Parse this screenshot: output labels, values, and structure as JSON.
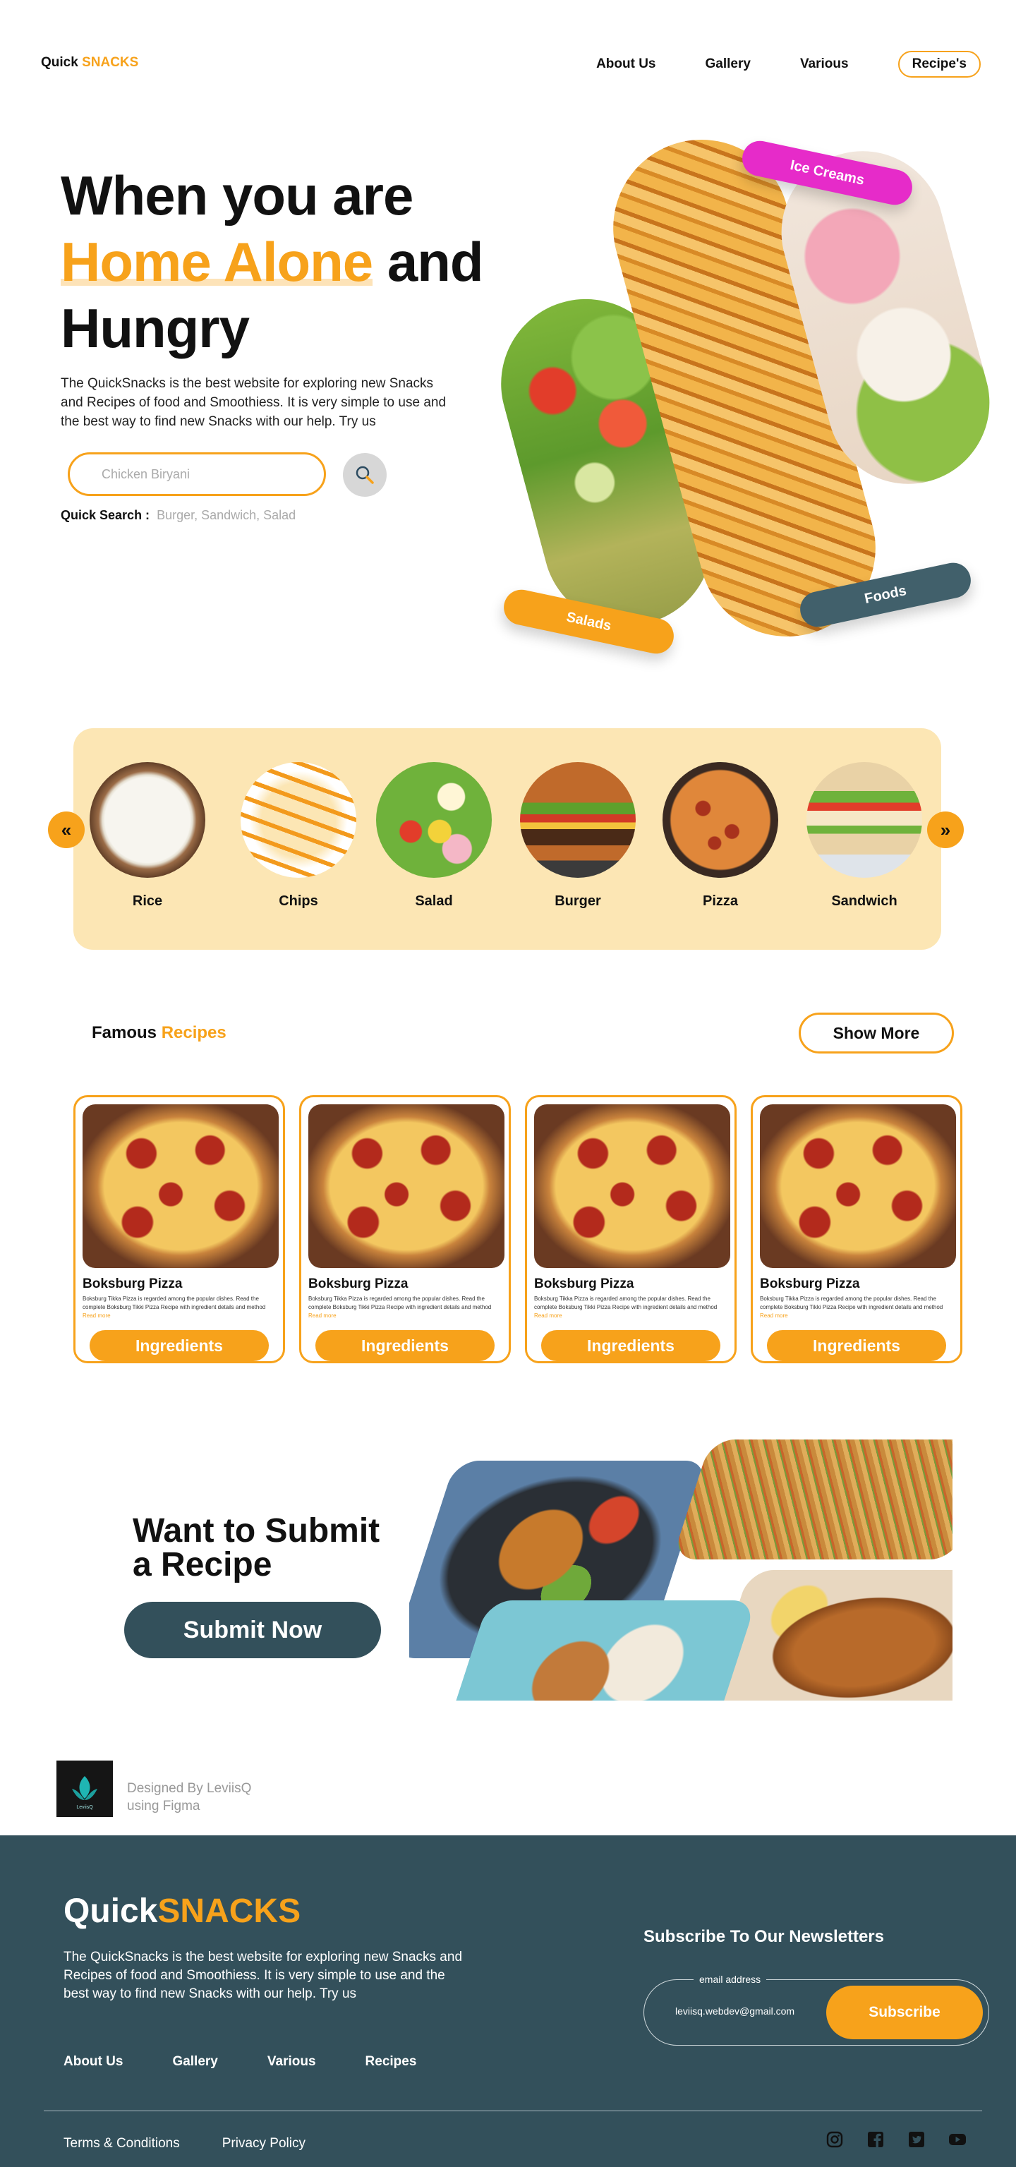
{
  "brand": {
    "quick": "Quick",
    "snacks": "SNACKS"
  },
  "nav": {
    "items": [
      {
        "label": "About Us"
      },
      {
        "label": "Gallery"
      },
      {
        "label": "Various"
      }
    ],
    "cta": "Recipe's"
  },
  "hero": {
    "line1": "When you are",
    "highlight": "Home Alone",
    "and": " and",
    "line3": "Hungry",
    "description": "The QuickSnacks is the best website for exploring new Snacks and Recipes of food and Smoothiess. It is very simple to use and the best way to find new Snacks with our help. Try us",
    "search_placeholder": "Chicken Biryani",
    "quick_search_label": "Quick Search :",
    "quick_search_tags": "Burger, Sandwich, Salad",
    "tags": {
      "ice_creams": "Ice Creams",
      "salads": "Salads",
      "foods": "Foods"
    },
    "colors": {
      "ice_tag": "#e62bc9",
      "salad_tag": "#f7a21b",
      "food_tag": "#41606b"
    }
  },
  "categories": {
    "prev_icon": "double-chevron-left-icon",
    "next_icon": "double-chevron-right-icon",
    "items": [
      {
        "label": "Rice"
      },
      {
        "label": "Chips"
      },
      {
        "label": "Salad"
      },
      {
        "label": "Burger"
      },
      {
        "label": "Pizza"
      },
      {
        "label": "Sandwich"
      }
    ]
  },
  "famous": {
    "title": "Famous",
    "highlight": "Recipes",
    "show_more": "Show More",
    "cards": [
      {
        "name": "Boksburg Pizza",
        "desc": "Boksburg Tikka Pizza is regarded among the popular dishes. Read the complete Boksburg Tikki Pizza Recipe with ingredient details and method",
        "read": "Read more",
        "button": "Ingredients"
      },
      {
        "name": "Boksburg Pizza",
        "desc": "Boksburg Tikka Pizza is regarded among the popular dishes. Read the complete Boksburg Tikki Pizza Recipe with ingredient details and method",
        "read": "Read more",
        "button": "Ingredients"
      },
      {
        "name": "Boksburg Pizza",
        "desc": "Boksburg Tikka Pizza is regarded among the popular dishes. Read the complete Boksburg Tikki Pizza Recipe with ingredient details and method",
        "read": "Read more",
        "button": "Ingredients"
      },
      {
        "name": "Boksburg Pizza",
        "desc": "Boksburg Tikka Pizza is regarded among the popular dishes. Read the complete Boksburg Tikki Pizza Recipe with ingredient details and method",
        "read": "Read more",
        "button": "Ingredients"
      }
    ]
  },
  "submit": {
    "line1": "Want to Submit",
    "line2": "a Recipe",
    "button": "Submit Now"
  },
  "designer": {
    "line1": "Designed By LeviisQ",
    "line2": "using Figma",
    "logo_text": "LeviisQ"
  },
  "footer": {
    "brand_quick": "Quick",
    "brand_snacks": "SNACKS",
    "description": "The QuickSnacks is the best website for exploring new Snacks and Recipes of food and Smoothiess. It is very simple to use and the best way to find new Snacks with our help. Try us",
    "links": [
      {
        "label": "About Us"
      },
      {
        "label": "Gallery"
      },
      {
        "label": "Various"
      },
      {
        "label": "Recipes"
      }
    ],
    "newsletter_title": "Subscribe  To Our Newsletters",
    "email_label": "email address",
    "email_value": "leviisq.webdev@gmail.com",
    "subscribe": "Subscribe",
    "terms": "Terms & Conditions",
    "privacy": "Privacy Policy",
    "socials": [
      "instagram-icon",
      "facebook-icon",
      "twitter-icon",
      "youtube-icon"
    ]
  },
  "colors": {
    "accent": "#f7a21b",
    "dark": "#33505b",
    "panel": "#fce6b4"
  }
}
